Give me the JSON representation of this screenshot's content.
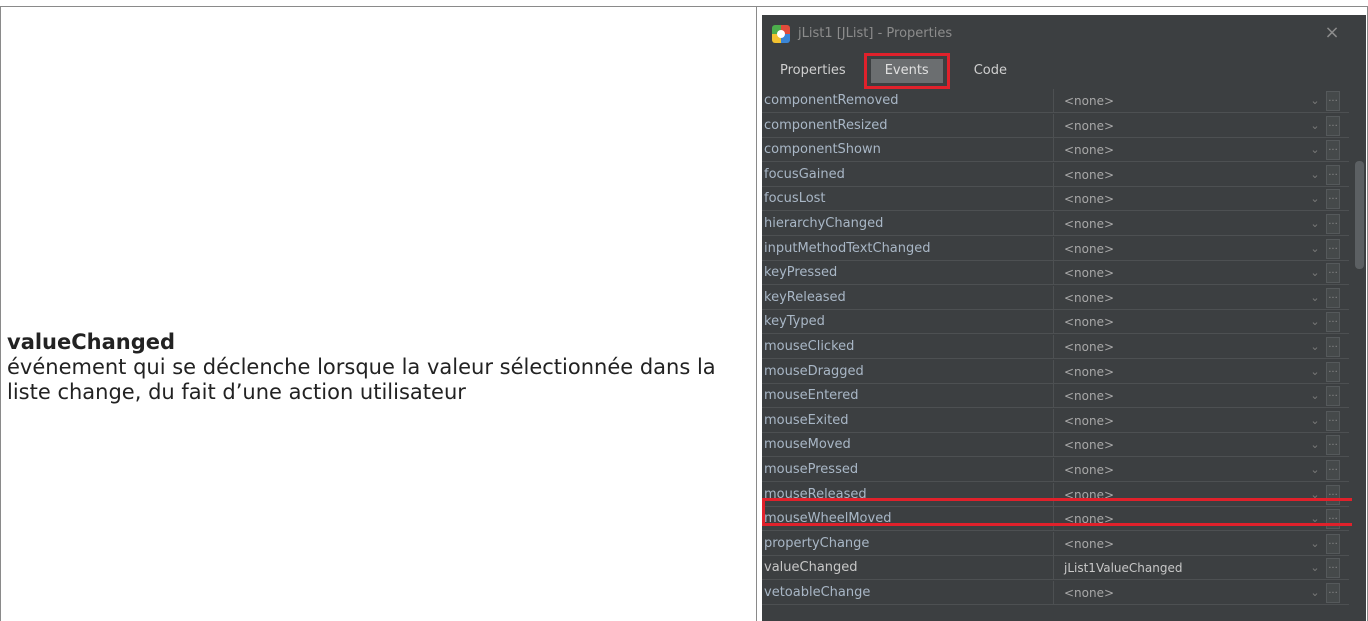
{
  "description": {
    "title": "valueChanged",
    "text": "événement qui se déclenche lorsque la valeur sélectionnée dans la liste change, du fait d’une action utilisateur"
  },
  "window": {
    "title": "jList1 [JList] - Properties",
    "close_icon": "×"
  },
  "tabs": [
    {
      "label": "Properties",
      "active": false
    },
    {
      "label": "Events",
      "active": true
    },
    {
      "label": "Code",
      "active": false
    }
  ],
  "events": [
    {
      "name": "componentRemoved",
      "value": "<none>"
    },
    {
      "name": "componentResized",
      "value": "<none>"
    },
    {
      "name": "componentShown",
      "value": "<none>"
    },
    {
      "name": "focusGained",
      "value": "<none>"
    },
    {
      "name": "focusLost",
      "value": "<none>"
    },
    {
      "name": "hierarchyChanged",
      "value": "<none>"
    },
    {
      "name": "inputMethodTextChanged",
      "value": "<none>"
    },
    {
      "name": "keyPressed",
      "value": "<none>"
    },
    {
      "name": "keyReleased",
      "value": "<none>"
    },
    {
      "name": "keyTyped",
      "value": "<none>"
    },
    {
      "name": "mouseClicked",
      "value": "<none>"
    },
    {
      "name": "mouseDragged",
      "value": "<none>"
    },
    {
      "name": "mouseEntered",
      "value": "<none>"
    },
    {
      "name": "mouseExited",
      "value": "<none>"
    },
    {
      "name": "mouseMoved",
      "value": "<none>"
    },
    {
      "name": "mousePressed",
      "value": "<none>"
    },
    {
      "name": "mouseReleased",
      "value": "<none>"
    },
    {
      "name": "mouseWheelMoved",
      "value": "<none>"
    },
    {
      "name": "propertyChange",
      "value": "<none>"
    },
    {
      "name": "valueChanged",
      "value": "jList1ValueChanged"
    },
    {
      "name": "vetoableChange",
      "value": "<none>"
    }
  ],
  "dropdown_glyph": "⌄",
  "ellipsis_glyph": "...",
  "colors": {
    "highlight": "#e0212b",
    "panel_bg": "#3c3f41"
  }
}
